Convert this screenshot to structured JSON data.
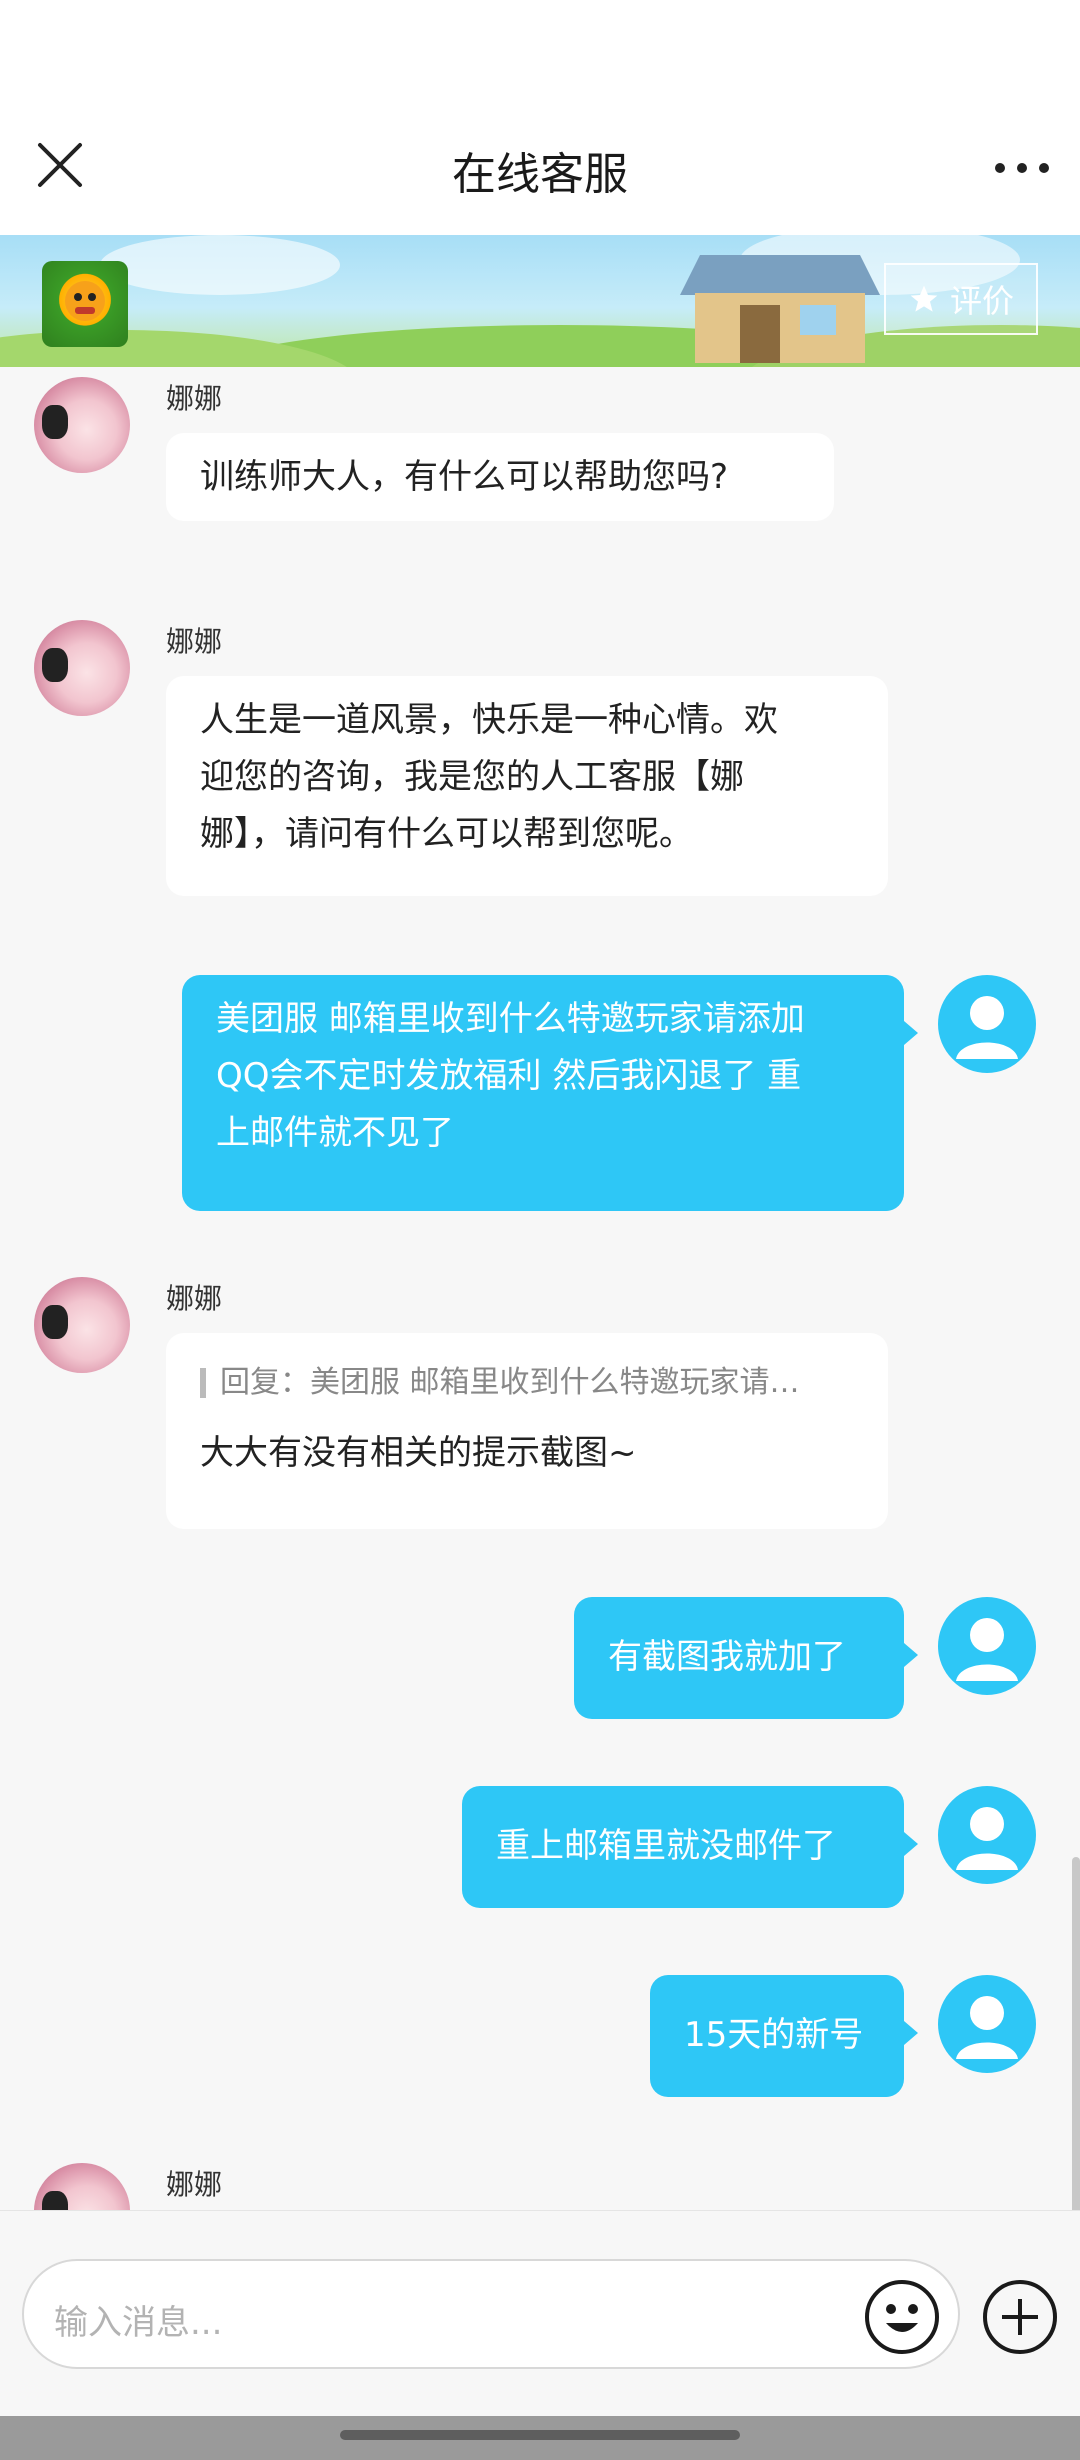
{
  "header": {
    "title": "在线客服",
    "close_icon": "close-icon",
    "more_icon": "more-dots-icon"
  },
  "banner": {
    "rate_label": "评价",
    "rate_icon": "star-icon"
  },
  "agent_name": "娜娜",
  "messages": [
    {
      "from": "agent",
      "name": "娜娜",
      "text": "训练师大人，有什么可以帮助您吗?"
    },
    {
      "from": "agent",
      "name": "娜娜",
      "lines": [
        "人生是一道风景，快乐是一种心情。欢",
        "迎您的咨询，我是您的人工客服【娜",
        "娜】，请问有什么可以帮到您呢。"
      ]
    },
    {
      "from": "user",
      "lines": [
        "美团服 邮箱里收到什么特邀玩家请添加",
        "QQ会不定时发放福利 然后我闪退了 重",
        "上邮件就不见了"
      ]
    },
    {
      "from": "agent",
      "name": "娜娜",
      "quote": "回复：美团服 邮箱里收到什么特邀玩家请…",
      "text": "大大有没有相关的提示截图~"
    },
    {
      "from": "user",
      "text": "有截图我就加了"
    },
    {
      "from": "user",
      "text": "重上邮箱里就没邮件了"
    },
    {
      "from": "user",
      "text": "15天的新号"
    },
    {
      "from": "agent",
      "name": "娜娜"
    }
  ],
  "input": {
    "placeholder": "输入消息...",
    "emoji_icon": "emoji-icon",
    "plus_icon": "plus-icon"
  },
  "colors": {
    "user_bubble": "#2ec7f6",
    "background": "#f7f7f7",
    "agent_bubble": "#ffffff"
  }
}
